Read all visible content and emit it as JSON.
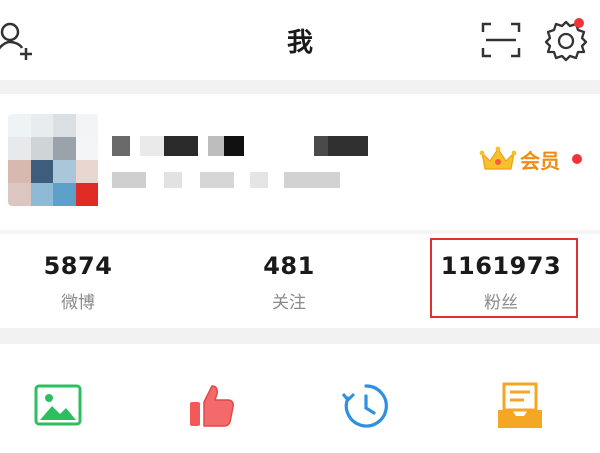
{
  "header": {
    "title": "我",
    "icons": [
      "add-friend-icon",
      "scan-icon",
      "settings-icon"
    ],
    "settings_badge_color": "#f2343a"
  },
  "profile": {
    "vip_label": "会员",
    "vip_color": "#f08c10",
    "badge_color": "#f2343a"
  },
  "stats": [
    {
      "value": "5874",
      "label": "微博"
    },
    {
      "value": "481",
      "label": "关注"
    },
    {
      "value": "1161973",
      "label": "粉丝"
    }
  ],
  "highlight_color": "#e0302f",
  "tools": {
    "icons": [
      "photo-album-icon",
      "thumbs-up-icon",
      "history-clock-icon",
      "drafts-tray-icon"
    ]
  }
}
